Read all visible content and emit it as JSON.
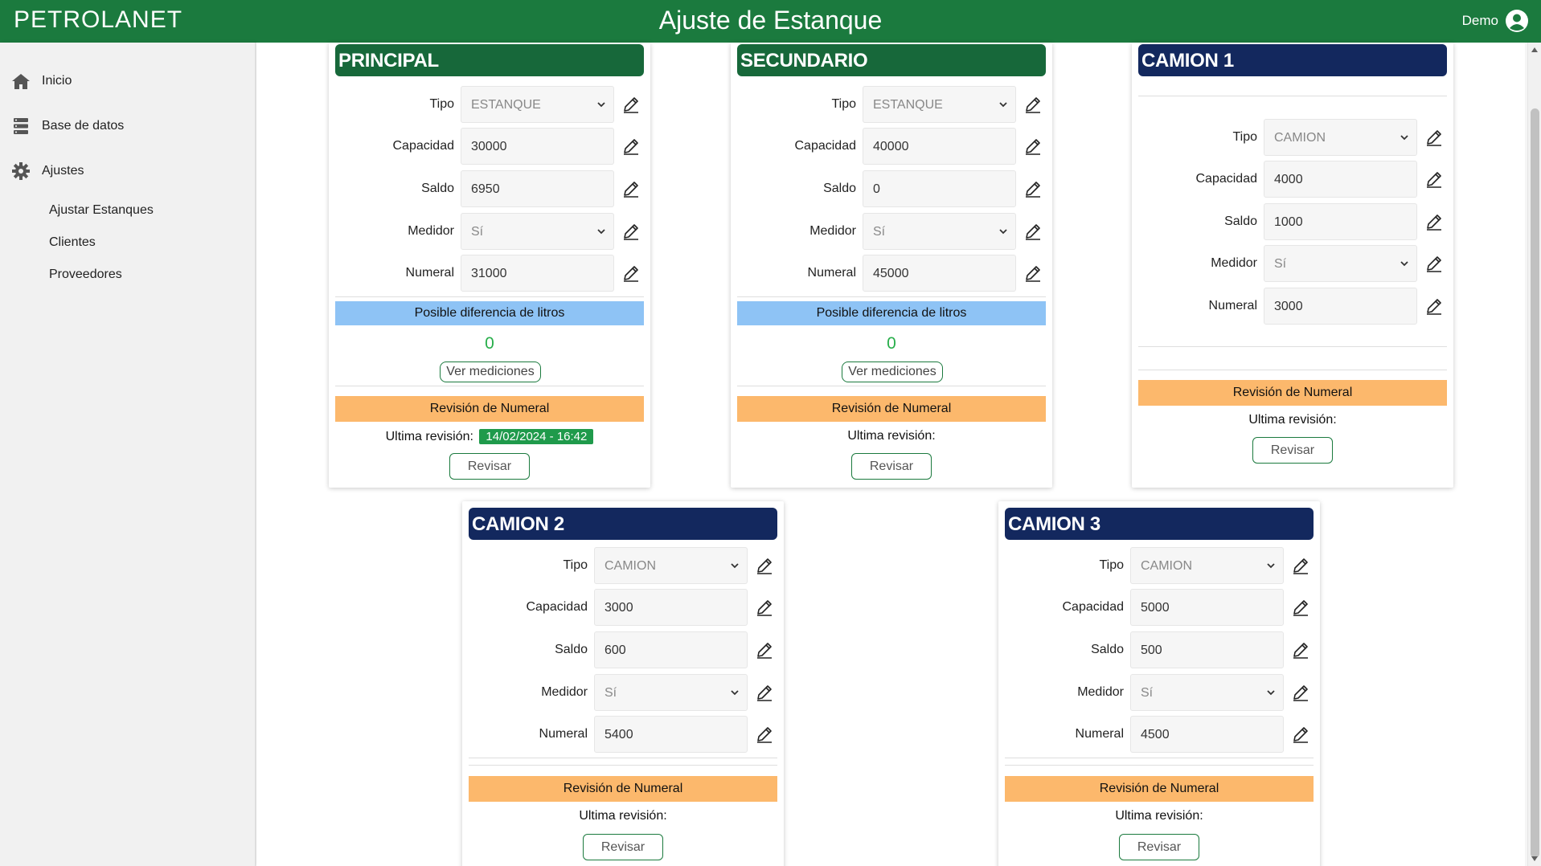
{
  "header": {
    "brand": "PETROLANET",
    "title": "Ajuste de Estanque",
    "user": "Demo"
  },
  "sidebar": {
    "items": [
      {
        "label": "Inicio",
        "icon": "home-icon"
      },
      {
        "label": "Base de datos",
        "icon": "database-icon"
      },
      {
        "label": "Ajustes",
        "icon": "gear-icon"
      }
    ],
    "sub_items": [
      {
        "label": "Ajustar Estanques"
      },
      {
        "label": "Clientes"
      },
      {
        "label": "Proveedores"
      }
    ]
  },
  "labels": {
    "tipo": "Tipo",
    "capacidad": "Capacidad",
    "saldo": "Saldo",
    "medidor": "Medidor",
    "numeral": "Numeral",
    "diferencia": "Posible diferencia de litros",
    "ver_mediciones": "Ver mediciones",
    "revision": "Revisión de Numeral",
    "ultima": "Ultima revisión:",
    "revisar": "Revisar"
  },
  "colors": {
    "green_header": "#17683a",
    "navy_header": "#13285e",
    "diff_bar": "#8ec3f5",
    "revision_bar": "#fcb86c",
    "top_bar": "#1b7a3e"
  },
  "tanks": [
    {
      "name": "PRINCIPAL",
      "tipo": "ESTANQUE",
      "capacidad": "30000",
      "saldo": "6950",
      "medidor": "Sí",
      "numeral": "31000",
      "diferencia": "0",
      "ultima_fecha": "14/02/2024 - 16:42"
    },
    {
      "name": "SECUNDARIO",
      "tipo": "ESTANQUE",
      "capacidad": "40000",
      "saldo": "0",
      "medidor": "Sí",
      "numeral": "45000",
      "diferencia": "0",
      "ultima_fecha": ""
    },
    {
      "name": "CAMION 1",
      "tipo": "CAMION",
      "capacidad": "4000",
      "saldo": "1000",
      "medidor": "Sí",
      "numeral": "3000",
      "ultima_fecha": ""
    },
    {
      "name": "CAMION 2",
      "tipo": "CAMION",
      "capacidad": "3000",
      "saldo": "600",
      "medidor": "Sí",
      "numeral": "5400",
      "ultima_fecha": ""
    },
    {
      "name": "CAMION 3",
      "tipo": "CAMION",
      "capacidad": "5000",
      "saldo": "500",
      "medidor": "Sí",
      "numeral": "4500",
      "ultima_fecha": ""
    }
  ]
}
